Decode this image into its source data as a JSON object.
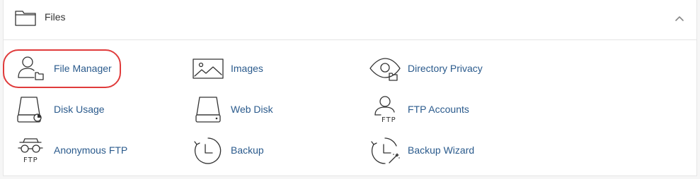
{
  "panel": {
    "title": "Files",
    "header_icon": "folder-icon",
    "collapse_icon": "chevron-up-icon"
  },
  "highlight_color": "#e03b3b",
  "link_color": "#2a5a8c",
  "items": [
    {
      "label": "File Manager",
      "icon": "user-folder-icon"
    },
    {
      "label": "Images",
      "icon": "image-icon"
    },
    {
      "label": "Directory Privacy",
      "icon": "eye-folder-icon"
    },
    {
      "label": "Disk Usage",
      "icon": "disk-usage-icon"
    },
    {
      "label": "Web Disk",
      "icon": "drive-icon"
    },
    {
      "label": "FTP Accounts",
      "icon": "user-ftp-icon"
    },
    {
      "label": "Anonymous FTP",
      "icon": "spy-ftp-icon"
    },
    {
      "label": "Backup",
      "icon": "backup-clock-icon"
    },
    {
      "label": "Backup Wizard",
      "icon": "backup-wizard-icon"
    }
  ],
  "ftp_badge": "FTP"
}
